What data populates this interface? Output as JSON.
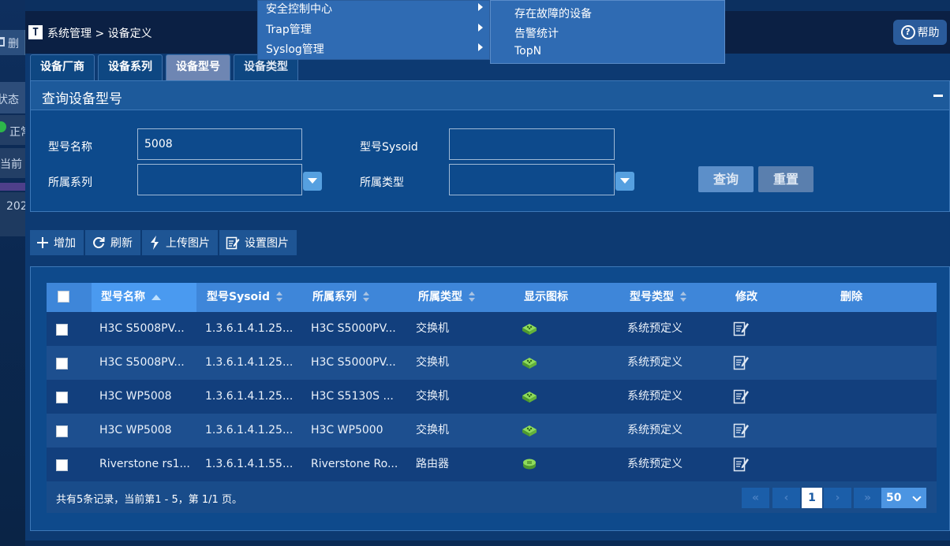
{
  "background": {
    "delete_label": "删",
    "status_header": "状态",
    "status_value": "正常",
    "current_label": "当前",
    "date_prefix": "202"
  },
  "window": {
    "breadcrumb": "系统管理 > 设备定义",
    "help_label": "帮助"
  },
  "tabs": [
    {
      "label": "设备厂商",
      "active": false
    },
    {
      "label": "设备系列",
      "active": false
    },
    {
      "label": "设备型号",
      "active": true
    },
    {
      "label": "设备类型",
      "active": false
    }
  ],
  "query": {
    "title": "查询设备型号",
    "model_name_label": "型号名称",
    "model_name_value": "5008",
    "sysoid_label": "型号Sysoid",
    "sysoid_value": "",
    "series_label": "所属系列",
    "series_value": "",
    "type_label": "所属类型",
    "type_value": "",
    "search_label": "查询",
    "reset_label": "重置"
  },
  "toolbar": {
    "add": "增加",
    "refresh": "刷新",
    "upload": "上传图片",
    "set_image": "设置图片"
  },
  "grid": {
    "headers": {
      "name": "型号名称",
      "sysoid": "型号Sysoid",
      "series": "所属系列",
      "type": "所属类型",
      "icon": "显示图标",
      "kind": "型号类型",
      "edit": "修改",
      "delete": "删除"
    },
    "rows": [
      {
        "name": "H3C S5008PV...",
        "sysoid": "1.3.6.1.4.1.25...",
        "series": "H3C S5000PV...",
        "type": "交换机",
        "icon": "switch-icon",
        "kind": "系统预定义"
      },
      {
        "name": "H3C S5008PV...",
        "sysoid": "1.3.6.1.4.1.25...",
        "series": "H3C S5000PV...",
        "type": "交换机",
        "icon": "switch-icon",
        "kind": "系统预定义"
      },
      {
        "name": "H3C WP5008",
        "sysoid": "1.3.6.1.4.1.25...",
        "series": "H3C S5130S ...",
        "type": "交换机",
        "icon": "switch-icon",
        "kind": "系统预定义"
      },
      {
        "name": "H3C WP5008",
        "sysoid": "1.3.6.1.4.1.25...",
        "series": "H3C WP5000",
        "type": "交换机",
        "icon": "switch-icon",
        "kind": "系统预定义"
      },
      {
        "name": "Riverstone rs1...",
        "sysoid": "1.3.6.1.4.1.55...",
        "series": "Riverstone Ro...",
        "type": "路由器",
        "icon": "router-icon",
        "kind": "系统预定义"
      }
    ],
    "footer": {
      "info": "共有5条记录，当前第1 - 5，第 1/1 页。",
      "current_page": "1",
      "page_size": "50"
    }
  },
  "menus": {
    "main": [
      {
        "label": "安全控制中心"
      },
      {
        "label": "Trap管理"
      },
      {
        "label": "Syslog管理"
      }
    ],
    "sub": [
      {
        "label": "存在故障的设备"
      },
      {
        "label": "告警统计"
      },
      {
        "label": "TopN"
      }
    ]
  },
  "colors": {
    "header": "#3e86d9",
    "active_tab": "#6e86b3",
    "device_icon": "#6ec24a"
  }
}
